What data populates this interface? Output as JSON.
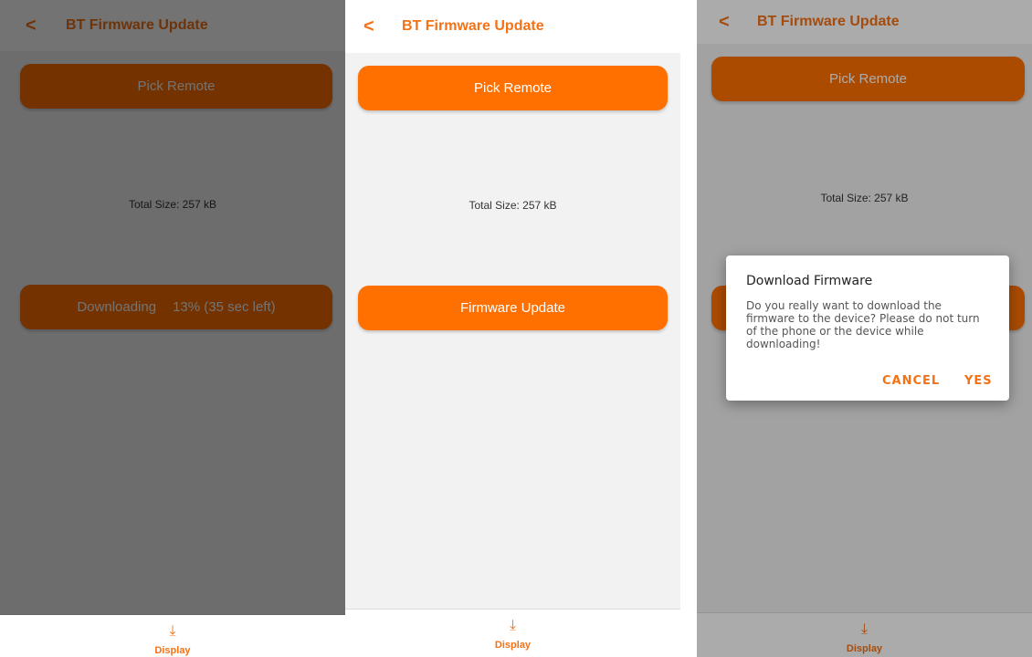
{
  "screens": [
    {
      "header": {
        "back_icon": "chevron-left-icon",
        "back_glyph": "<",
        "title": "BT Firmware Update"
      },
      "pick_button": "Pick Remote",
      "total_size": "Total Size: 257 kB",
      "download_status": {
        "prefix": "Downloading",
        "progress_percent": 13,
        "suffix": "13% (35 sec left)"
      },
      "footer": {
        "icon": "download-icon",
        "glyph": "⤓",
        "label": "Display"
      }
    },
    {
      "header": {
        "back_icon": "chevron-left-icon",
        "back_glyph": "<",
        "title": "BT Firmware Update"
      },
      "pick_button": "Pick Remote",
      "total_size": "Total Size: 257 kB",
      "update_button": "Firmware Update",
      "footer": {
        "icon": "download-icon",
        "glyph": "⤓",
        "label": "Display"
      }
    },
    {
      "header": {
        "back_icon": "chevron-left-icon",
        "back_glyph": "<",
        "title": "BT Firmware Update"
      },
      "pick_button": "Pick Remote",
      "total_size": "Total Size: 257 kB",
      "dialog": {
        "title": "Download Firmware",
        "message": "Do you really want to download the firmware to the device? Please do not turn of the phone or the device while downloading!",
        "cancel": "CANCEL",
        "yes": "YES"
      },
      "footer": {
        "icon": "download-icon",
        "glyph": "⤓",
        "label": "Display"
      }
    }
  ],
  "colors": {
    "accent": "#ff7000",
    "accent_text": "#f47216",
    "background": "#f2f2f2"
  }
}
